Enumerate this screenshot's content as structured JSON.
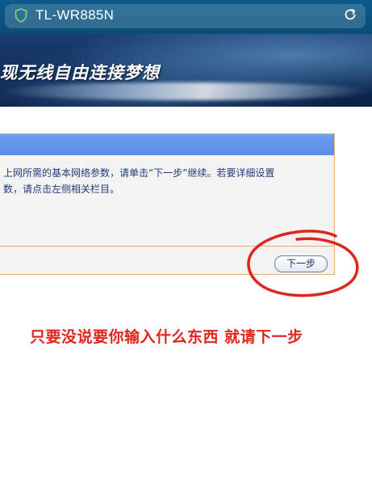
{
  "address_bar": {
    "url_text": "TL-WR885N",
    "secure_icon": "shield-icon",
    "reload_icon": "reload-icon"
  },
  "banner": {
    "slogan": "现无线自由连接梦想"
  },
  "panel": {
    "body_lines": [
      "上网所需的基本网络参数，请单击“下一步”继续。若要详细设置",
      "数，请点击左侧相关栏目。"
    ],
    "next_button_label": "下一步"
  },
  "annotation": {
    "text": "只要没说要你输入什么东西 就请下一步",
    "color": "#e0261c"
  },
  "colors": {
    "topbar": "#0d5a8a",
    "panel_header": "#6f9ff0",
    "panel_border": "#e5b070",
    "panel_text": "#243b7a"
  }
}
